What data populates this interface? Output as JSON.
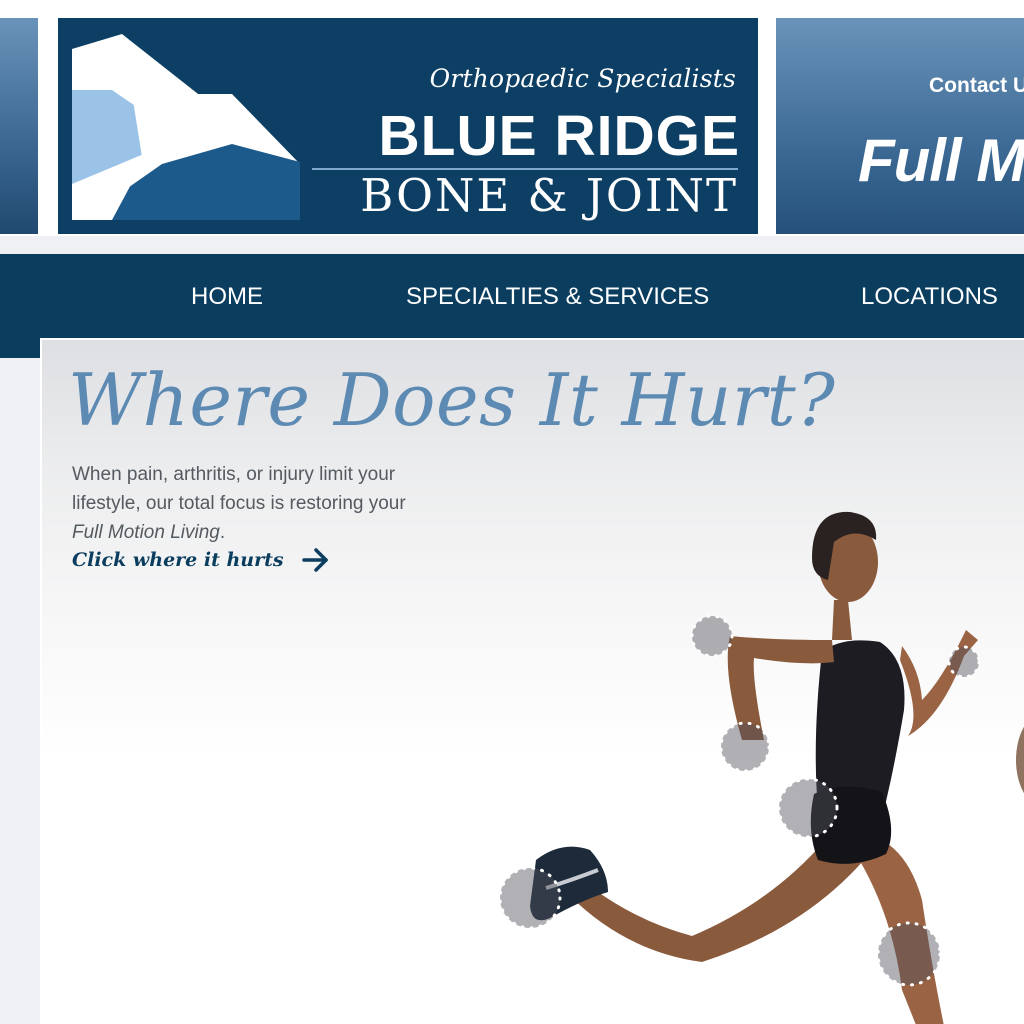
{
  "header": {
    "tagline": "Orthopaedic Specialists",
    "brand_line1": "BLUE RIDGE",
    "brand_line2": "BONE & JOINT",
    "contact_label": "Contact U",
    "promo_fragment": "Full M"
  },
  "nav": {
    "items": [
      {
        "label": "HOME"
      },
      {
        "label": "SPECIALTIES & SERVICES"
      },
      {
        "label": "LOCATIONS"
      }
    ]
  },
  "hero": {
    "title": "Where Does It Hurt?",
    "body_prefix": "When pain, arthritis, or injury limit your lifestyle, our total focus is restoring your ",
    "body_emphasis": "Full Motion Living",
    "body_suffix": ".",
    "cta_label": "Click where it hurts",
    "cta_icon": "arrow-right-icon"
  },
  "hotspots": [
    {
      "name": "elbow"
    },
    {
      "name": "wrist-right"
    },
    {
      "name": "hand-left"
    },
    {
      "name": "hip"
    },
    {
      "name": "foot-ankle"
    },
    {
      "name": "knee"
    }
  ],
  "colors": {
    "navy": "#0b3d5f",
    "title_blue": "#5c8ab3",
    "logo_light": "#9bc3e8",
    "logo_dark": "#1c5a8c"
  }
}
